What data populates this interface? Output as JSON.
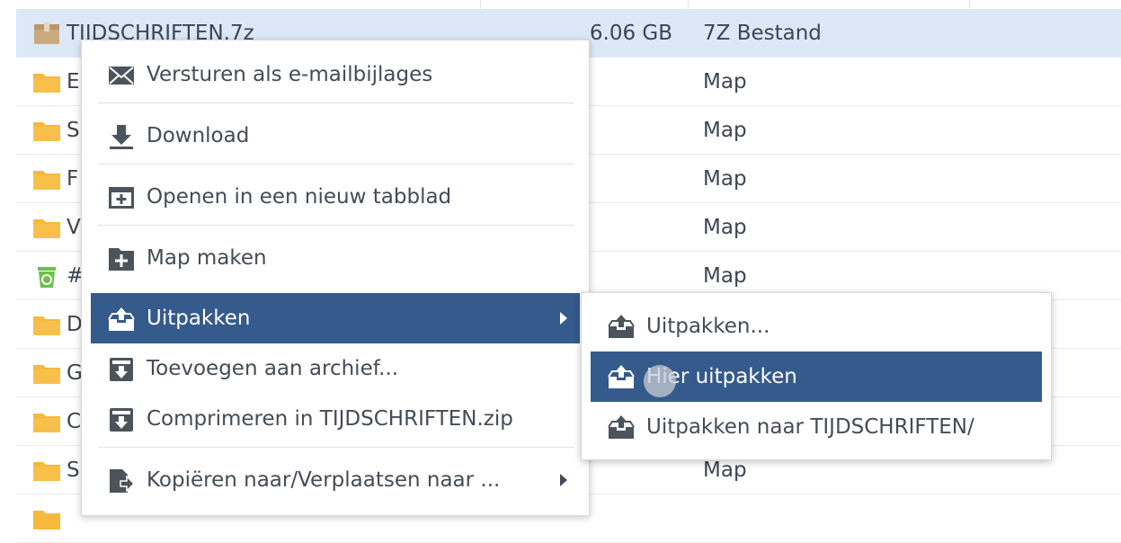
{
  "files": [
    {
      "name": "TIJDSCHRIFTEN.7z",
      "size": "6.06 GB",
      "type": "7Z Bestand",
      "icon": "archive-icon",
      "selected": true
    },
    {
      "name": "E",
      "size": "",
      "type": "Map",
      "icon": "folder-icon"
    },
    {
      "name": "S",
      "size": "",
      "type": "Map",
      "icon": "folder-icon"
    },
    {
      "name": "F",
      "size": "",
      "type": "Map",
      "icon": "folder-icon"
    },
    {
      "name": "V",
      "size": "",
      "type": "Map",
      "icon": "folder-icon"
    },
    {
      "name": "#",
      "size": "",
      "type": "Map",
      "icon": "recycle-bin-icon"
    },
    {
      "name": "D",
      "size": "",
      "type": "",
      "icon": "folder-icon"
    },
    {
      "name": "G",
      "size": "",
      "type": "",
      "icon": "folder-icon"
    },
    {
      "name": "C",
      "size": "",
      "type": "",
      "icon": "folder-icon"
    },
    {
      "name": "S",
      "size": "",
      "type": "Map",
      "icon": "folder-icon"
    }
  ],
  "context_menu": {
    "items": [
      {
        "label": "Versturen als e-mailbijlages",
        "icon": "envelope-icon"
      },
      {
        "label": "Download",
        "icon": "download-icon"
      },
      {
        "label": "Openen in een nieuw tabblad",
        "icon": "new-tab-icon"
      },
      {
        "label": "Map maken",
        "icon": "create-folder-icon"
      },
      {
        "label": "Uitpakken",
        "icon": "extract-icon",
        "active": true,
        "submenu": true
      },
      {
        "label": "Toevoegen aan archief...",
        "icon": "add-to-archive-icon"
      },
      {
        "label": "Comprimeren in TIJDSCHRIFTEN.zip",
        "icon": "compress-icon"
      },
      {
        "label": "Kopiëren naar/Verplaatsen naar ...",
        "icon": "copy-move-icon",
        "submenu": true
      }
    ]
  },
  "submenu": {
    "items": [
      {
        "label": "Uitpakken...",
        "icon": "extract-icon"
      },
      {
        "label": "Hier uitpakken",
        "icon": "extract-icon",
        "active": true
      },
      {
        "label": "Uitpakken naar TIJDSCHRIFTEN/",
        "icon": "extract-icon"
      }
    ]
  },
  "colors": {
    "accent": "#355a8c",
    "selected_row": "#dce8f8",
    "folder": "#f6b93b",
    "recycle": "#6cbf4a"
  }
}
